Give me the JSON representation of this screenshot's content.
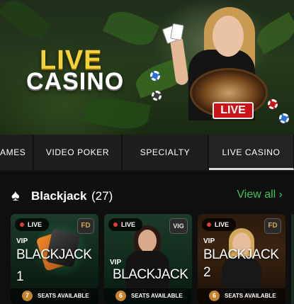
{
  "hero": {
    "title_line1": "LIVE",
    "title_line2": "CASINO",
    "badge": "LIVE"
  },
  "tabs": [
    {
      "label": "AMES",
      "active": false
    },
    {
      "label": "VIDEO POKER",
      "active": false
    },
    {
      "label": "SPECIALTY",
      "active": false
    },
    {
      "label": "LIVE CASINO",
      "active": true
    }
  ],
  "section": {
    "icon": "spade-icon",
    "title": "Blackjack",
    "count": "(27)",
    "view_all": "View all",
    "view_all_icon": "chevron-right-icon"
  },
  "colors": {
    "accent": "#39c35a",
    "live_red": "#c8151b",
    "gold": "#f5d23a"
  },
  "games": [
    {
      "live": "LIVE",
      "provider": "FD",
      "vip": "VIP",
      "title": "BLACKJACK",
      "number": "1",
      "seats": "7",
      "seats_label": "SEATS AVAILABLE"
    },
    {
      "live": "LIVE",
      "provider": "VIG",
      "vip": "VIP",
      "title": "BLACKJACK",
      "number": "",
      "seats": "6",
      "seats_label": "SEATS AVAILABLE"
    },
    {
      "live": "LIVE",
      "provider": "FD",
      "vip": "VIP",
      "title": "BLACKJACK",
      "number": "2",
      "seats": "6",
      "seats_label": "SEATS AVAILABLE"
    }
  ]
}
